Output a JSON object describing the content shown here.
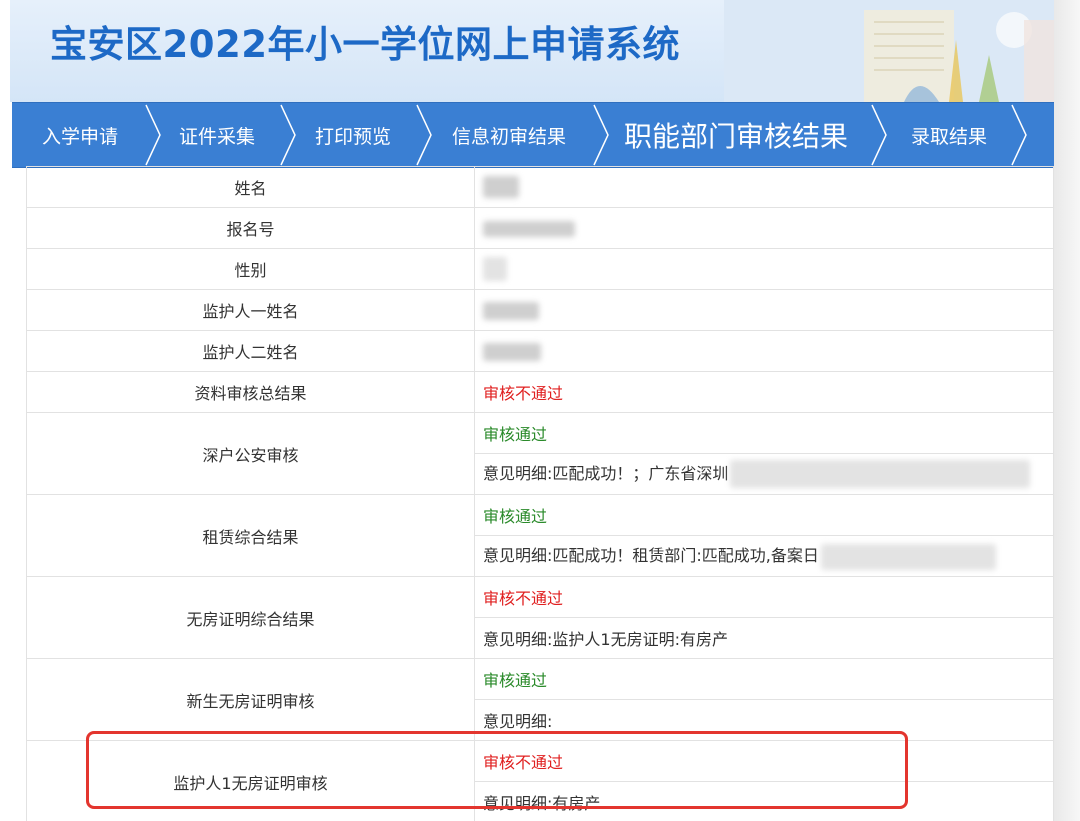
{
  "header": {
    "title": "宝安区2022年小一学位网上申请系统"
  },
  "nav": {
    "steps": [
      {
        "label": "入学申请"
      },
      {
        "label": "证件采集"
      },
      {
        "label": "打印预览"
      },
      {
        "label": "信息初审结果"
      },
      {
        "label": "职能部门审核结果"
      },
      {
        "label": "录取结果"
      }
    ],
    "active_index": 4
  },
  "rows": {
    "name": {
      "label": "姓名"
    },
    "reg_no": {
      "label": "报名号"
    },
    "gender": {
      "label": "性别"
    },
    "guardian1": {
      "label": "监护人一姓名"
    },
    "guardian2": {
      "label": "监护人二姓名"
    },
    "overall": {
      "label": "资料审核总结果",
      "status": "审核不通过"
    },
    "police": {
      "label": "深户公安审核",
      "status": "审核通过",
      "detail": "意见明细:匹配成功！；广东省深圳"
    },
    "rental": {
      "label": "租赁综合结果",
      "status": "审核通过",
      "detail": "意见明细:匹配成功！租赁部门:匹配成功,备案日"
    },
    "nohouse_total": {
      "label": "无房证明综合结果",
      "status": "审核不通过",
      "detail": "意见明细:监护人1无房证明:有房产"
    },
    "nohouse_student": {
      "label": "新生无房证明审核",
      "status": "审核通过",
      "detail": "意见明细:"
    },
    "nohouse_guardian1": {
      "label": "监护人1无房证明审核",
      "status": "审核不通过",
      "detail": "意见明细:有房产"
    }
  },
  "colors": {
    "nav_bg": "#3a7fd3",
    "title": "#1d69c6",
    "fail": "#e02020",
    "pass": "#2a8a2a",
    "highlight": "#e3352e"
  }
}
